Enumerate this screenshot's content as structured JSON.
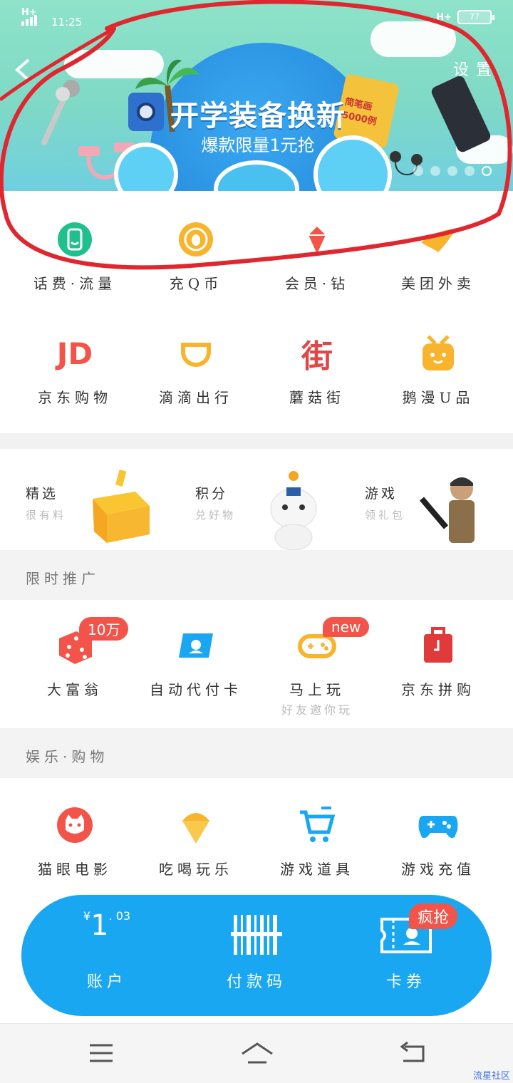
{
  "status_bar": {
    "network_left": "H+",
    "time": "11:25",
    "network_right": "H+",
    "battery": "77"
  },
  "header": {
    "settings_label": "设置"
  },
  "banner": {
    "title": "开学装备换新",
    "subtitle": "爆款限量1元抢",
    "product_text": "简笔画 5000例",
    "dots_count": 5,
    "active_dot": 4
  },
  "services_row1": [
    {
      "label": "话费·流量",
      "icon": "phone-icon",
      "color": "#1fc08b"
    },
    {
      "label": "充Q币",
      "icon": "qq-coin-icon",
      "color": "#f7b42c"
    },
    {
      "label": "会员·钻",
      "icon": "diamond-icon",
      "color": "#f25449"
    },
    {
      "label": "美团外卖",
      "icon": "meituan-icon",
      "color": "#f7b42c"
    }
  ],
  "services_row2": [
    {
      "label": "京东购物",
      "icon": "jd-icon",
      "text": "JD",
      "color": "#f25449"
    },
    {
      "label": "滴滴出行",
      "icon": "didi-icon",
      "color": "#f7b42c"
    },
    {
      "label": "蘑菇街",
      "icon": "mogujie-icon",
      "text": "街",
      "color": "#e04848"
    },
    {
      "label": "鹅漫U品",
      "icon": "eman-icon",
      "color": "#f7b42c"
    }
  ],
  "promo": [
    {
      "title": "精选",
      "sub": "很有料"
    },
    {
      "title": "积分",
      "sub": "兑好物"
    },
    {
      "title": "游戏",
      "sub": "领礼包"
    }
  ],
  "section_limited": {
    "title": "限时推广",
    "items": [
      {
        "label": "大富翁",
        "icon": "dice-icon",
        "badge": "10万"
      },
      {
        "label": "自动代付卡",
        "icon": "qq-card-icon",
        "badge": ""
      },
      {
        "label": "马上玩",
        "icon": "gamepad-icon",
        "badge": "new",
        "sub": "好友邀你玩"
      },
      {
        "label": "京东拼购",
        "icon": "jd-pingou-icon",
        "badge": ""
      }
    ]
  },
  "section_ent": {
    "title": "娱乐·购物",
    "items": [
      {
        "label": "猫眼电影",
        "icon": "cat-icon"
      },
      {
        "label": "吃喝玩乐",
        "icon": "icecream-icon"
      },
      {
        "label": "游戏道具",
        "icon": "cart-icon"
      },
      {
        "label": "游戏充值",
        "icon": "controller-icon"
      }
    ]
  },
  "wallet": {
    "currency": "¥",
    "balance_int": "1",
    "balance_dec": ". 03",
    "account_label": "账户",
    "pay_code_label": "付款码",
    "coupon_label": "卡券",
    "coupon_badge": "疯抢"
  },
  "watermark": "流星社区",
  "colors": {
    "accent_blue": "#1aa7f2",
    "badge_red": "#f25449",
    "orange": "#f7b42c"
  }
}
